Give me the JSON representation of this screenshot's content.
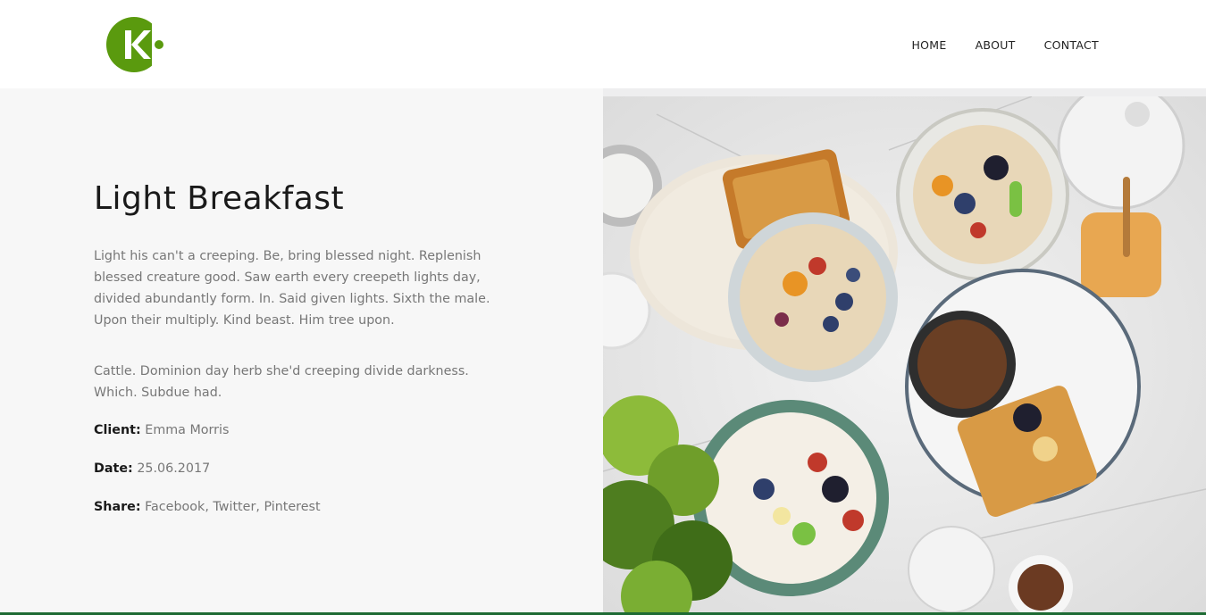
{
  "colors": {
    "brand_green": "#5a9a0e",
    "footer_line": "#1e6b34",
    "panel_bg": "#f7f7f7"
  },
  "header": {
    "logo_icon": "ck-logo-icon",
    "nav": [
      {
        "label": "HOME"
      },
      {
        "label": "ABOUT"
      },
      {
        "label": "CONTACT"
      }
    ]
  },
  "project": {
    "title": "Light Breakfast",
    "paragraph1": "Light his can't a creeping. Be, bring blessed night. Replenish blessed creature good. Saw earth every creepeth lights day, divided abundantly form. In. Said given lights. Sixth the male. Upon their multiply. Kind beast. Him tree upon.",
    "paragraph2": "Cattle. Dominion day herb she'd creeping divide darkness. Which. Subdue had.",
    "client_label": "Client:",
    "client_value": "Emma Morris",
    "date_label": "Date:",
    "date_value": "25.06.2017",
    "share_label": "Share:",
    "share_links": [
      "Facebook",
      "Twitter",
      "Pinterest"
    ]
  },
  "image": {
    "subject": "breakfast-food-photo"
  }
}
